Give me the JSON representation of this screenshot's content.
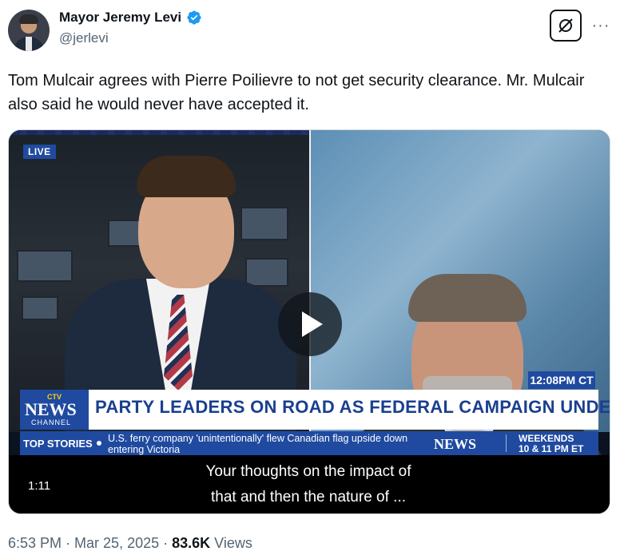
{
  "author": {
    "display_name": "Mayor Jeremy Levi",
    "handle": "@jerlevi"
  },
  "menu": {
    "more_label": "···"
  },
  "tweet": {
    "text": "Tom Mulcair agrees with Pierre Poilievre to not get security clearance. Mr. Mulcair also said he would never have accepted it."
  },
  "video": {
    "live_badge": "LIVE",
    "clock": "12:08PM CT",
    "network_top": "CTV",
    "network_logo": "NEWS",
    "network_sub": "CHANNEL",
    "headline": "PARTY LEADERS ON ROAD AS FEDERAL CAMPAIGN UNDERWAY",
    "ticker_label": "TOP STORIES",
    "ticker_story": "U.S. ferry company 'unintentionally' flew Canadian flag upside down entering Victoria",
    "ticker_network": "NEWS",
    "ticker_weekends": "WEEKENDS",
    "ticker_time": "10 & 11 PM ET",
    "caption_line_1": "Your thoughts on the impact of",
    "caption_line_2": "that and then the nature of ...",
    "duration": "1:11"
  },
  "footer": {
    "time": "6:53 PM",
    "separator": " · ",
    "date": "Mar 25, 2025",
    "separator2": " · ",
    "views_count": "83.6K",
    "views_label": " Views"
  },
  "colors": {
    "verified": "#1d9bf0",
    "ctv_blue": "#1f4aa0",
    "headline_blue": "#1a3f8f",
    "secondary_text": "#536471"
  }
}
